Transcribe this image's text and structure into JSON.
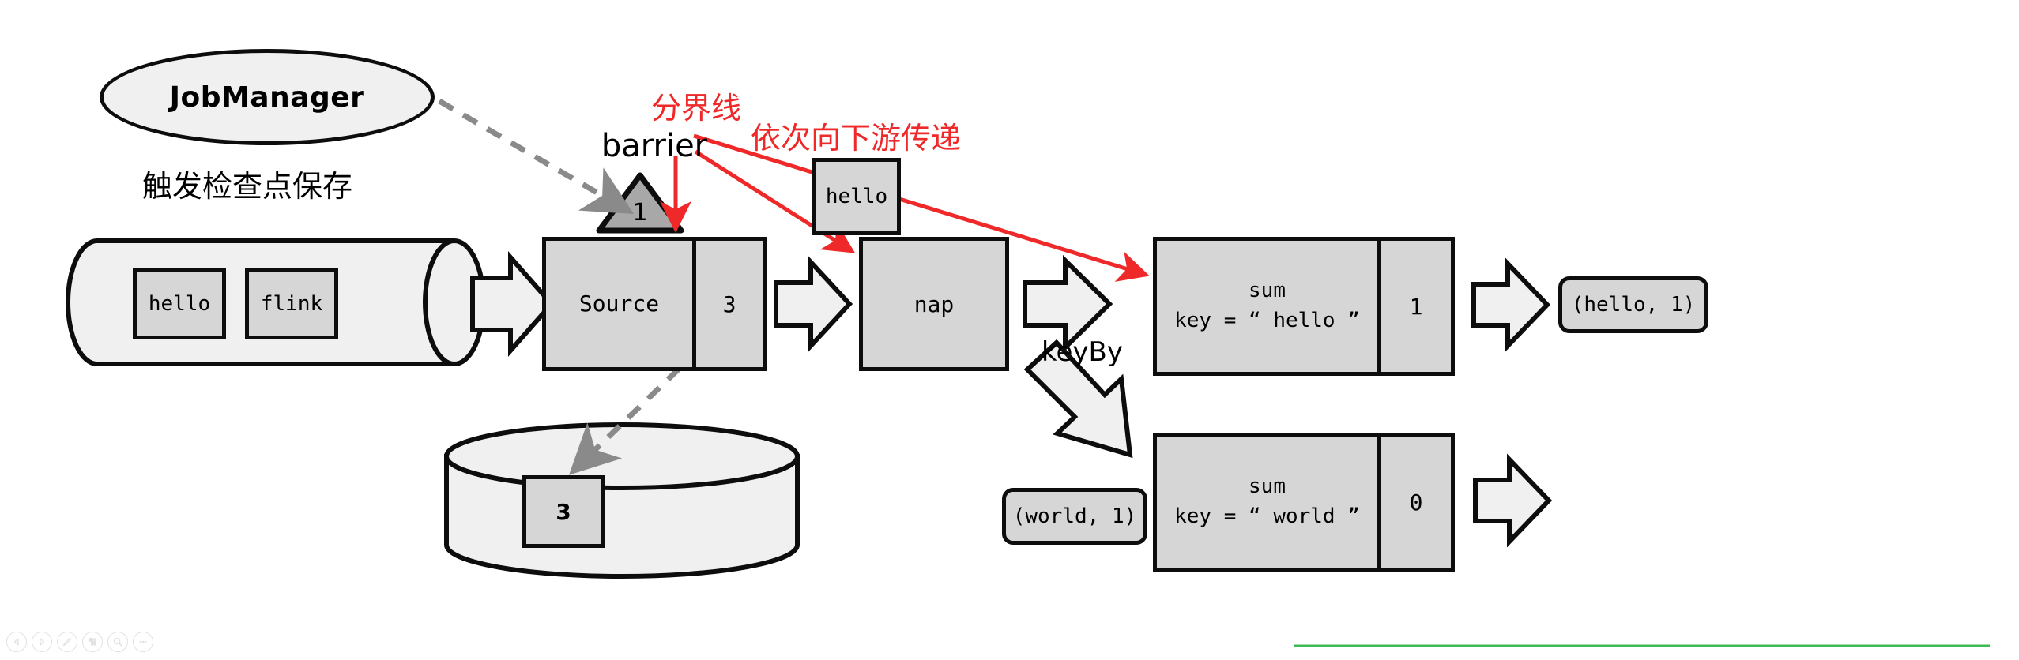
{
  "diagram": {
    "title_node": {
      "label": "JobManager"
    },
    "captions": {
      "trigger_checkpoint": "触发检查点保存",
      "boundary_line": "分界线",
      "pass_downstream": "依次向下游传递",
      "barrier": "barrier",
      "key_by": "keyBy"
    },
    "input_queue": {
      "items": [
        {
          "label": "hello"
        },
        {
          "label": "flink"
        }
      ]
    },
    "barrier_marker": {
      "label": "1"
    },
    "barrier_record": {
      "label": "hello"
    },
    "source_operator": {
      "label": "Source",
      "count": "3"
    },
    "map_operator": {
      "label": "nap"
    },
    "state_store": {
      "label": "3"
    },
    "sum_hello": {
      "line1": "sum",
      "line2": "key = “ hello ”",
      "count": "1"
    },
    "sum_world": {
      "line1": "sum",
      "line2": "key = “ world ”",
      "count": "0"
    },
    "output_hello": {
      "label": "(hello, 1)"
    },
    "output_world": {
      "label": "(world, 1)"
    },
    "colors": {
      "stroke": "#0d0d0d",
      "box_fill": "#d6d6d6",
      "cylinder_fill": "#f0f0f0",
      "arrow_fill": "#f0f0f0",
      "triangle_fill": "#a8a8a8",
      "annotation_red": "#ef2929",
      "dashed_gray": "#8a8a8a",
      "footer_green": "#3cba54",
      "toolbar_icon": "#e2e2e2"
    }
  },
  "toolbar": {
    "buttons": [
      {
        "name": "prev-button",
        "icon": "triangle-left-icon"
      },
      {
        "name": "next-button",
        "icon": "triangle-right-icon"
      },
      {
        "name": "edit-button",
        "icon": "pencil-icon"
      },
      {
        "name": "layers-button",
        "icon": "layers-icon"
      },
      {
        "name": "zoom-button",
        "icon": "magnifier-icon"
      },
      {
        "name": "more-button",
        "icon": "ellipsis-icon"
      }
    ]
  }
}
